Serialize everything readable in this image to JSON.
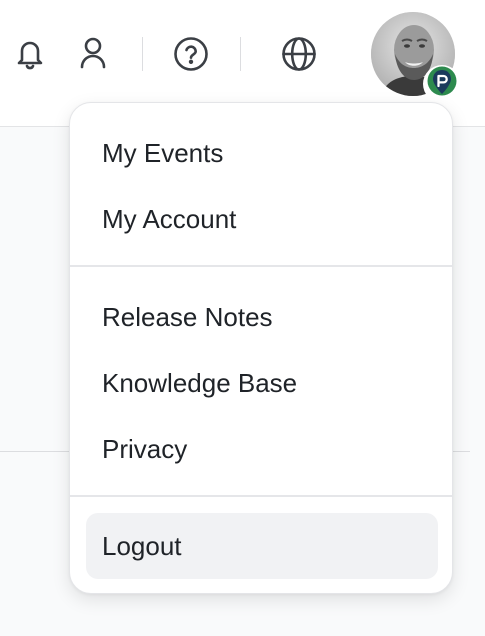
{
  "header": {
    "icons": {
      "notifications": "bell-icon",
      "profile": "user-icon",
      "help": "help-circle-icon",
      "language": "globe-icon"
    },
    "badge_icon": "map-pin-icon"
  },
  "menu": {
    "group1": [
      "My Events",
      "My Account"
    ],
    "group2": [
      "Release Notes",
      "Knowledge Base",
      "Privacy"
    ],
    "logout": "Logout"
  },
  "colors": {
    "text": "#1f2328",
    "badge_green": "#2d8a4e",
    "badge_navy": "#1b3a5c",
    "hover_bg": "#f1f2f4"
  }
}
